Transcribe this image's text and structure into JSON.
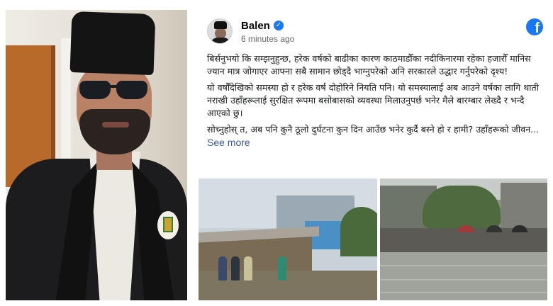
{
  "post": {
    "author": "Balen",
    "verified_mark": "✓",
    "time": "6 minutes ago",
    "platform_logo": "f",
    "paragraphs": [
      "बिर्सनुभयो कि सम्झनुहुन्छ, हरेक वर्षको बाढीका कारण काठमाडौँका नदीकिनारमा रहेका हजारौँ मानिस ज्यान मात्र जोगाएर आफ्ना सबै सामान छोड्दै भाग्नुपरेको अनि सरकारले उद्धार गर्नुपरेको दृश्य!",
      "यो वर्षौँदेखिको समस्या हो र हरेक वर्ष दोहोरिने नियति पनि। यो समस्यालाई अब आउने वर्षका लागि थाती नराखी उहाँहरूलाई सुरक्षित रूपमा बसोबासको व्यवस्था मिलाउनुपर्छ भनेर मैले बारम्बार लेख्दै र भन्दै आएको छु।"
    ],
    "last_paragraph": "सोच्नुहोस् त, अब पनि कुनै ठूलो दुर्घटना कुन दिन आउँछ भनेर कुर्दै बस्ने हो र हामी? उहाँहरूको जीवन...",
    "see_more": "See more"
  },
  "colors": {
    "brand": "#1877f2",
    "link": "#385898",
    "secondary_text": "#65676b"
  },
  "icons": {
    "verified": "verified-badge-icon",
    "platform": "facebook-logo-icon"
  }
}
